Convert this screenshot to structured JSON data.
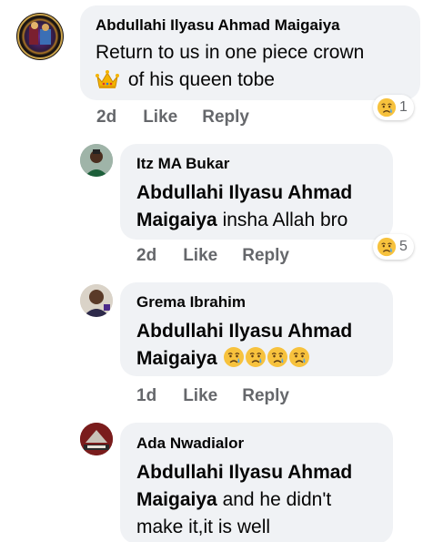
{
  "comments": [
    {
      "author": "Abdullahi Ilyasu Ahmad Maigaiya",
      "line1": "Return to us in one piece crown",
      "line2": "of his queen tobe",
      "time": "2d",
      "like": "Like",
      "reply": "Reply",
      "reaction_count": "1"
    },
    {
      "author": "Itz MA Bukar",
      "mention1": "Abdullahi Ilyasu Ahmad",
      "mention2": "Maigaiya",
      "text": "insha Allah bro",
      "time": "2d",
      "like": "Like",
      "reply": "Reply",
      "reaction_count": "5"
    },
    {
      "author": "Grema Ibrahim",
      "mention1": "Abdullahi Ilyasu Ahmad",
      "mention2": "Maigaiya",
      "time": "1d",
      "like": "Like",
      "reply": "Reply"
    },
    {
      "author": "Ada Nwadialor",
      "mention1": "Abdullahi Ilyasu Ahmad",
      "mention2": "Maigaiya",
      "text": "and he didn't",
      "line3": "make it,it is well"
    }
  ],
  "icons": {
    "crown": "crown-emoji",
    "reaction": "sad-face-emoji",
    "crying": "crying-face-emoji"
  },
  "colors": {
    "bubble": "#f0f2f5",
    "secondary_text": "#65676b",
    "emoji_yellow": "#f7c23d"
  }
}
